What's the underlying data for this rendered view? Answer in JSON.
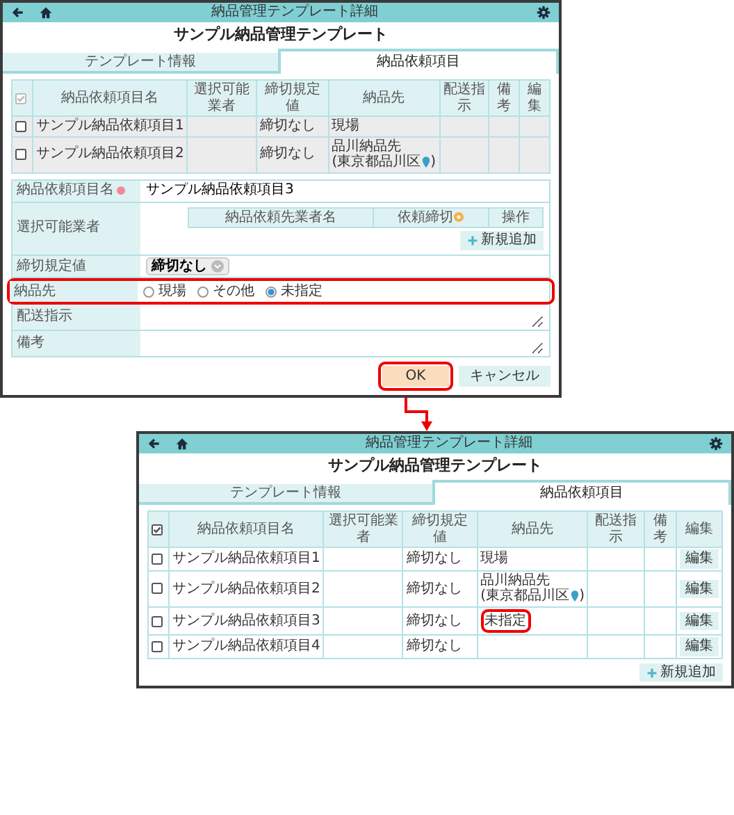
{
  "screens": [
    {
      "header": {
        "title": "納品管理テンプレート詳細"
      },
      "page_title": "サンプル納品管理テンプレート",
      "tabs": [
        {
          "label": "テンプレート情報",
          "selected": false
        },
        {
          "label": "納品依頼項目",
          "selected": true
        }
      ],
      "table": {
        "disabled": true,
        "select_all": {
          "checked": true,
          "disabled": true
        },
        "columns": [
          "納品依頼項目名",
          "選択可能業者",
          "締切規定値",
          "納品先",
          "配送指示",
          "備考",
          "編集"
        ],
        "rows": [
          {
            "selected": false,
            "name": "サンプル納品依頼項目1",
            "deadline": "締切なし",
            "destination": {
              "lines": [
                "現場"
              ]
            }
          },
          {
            "selected": false,
            "name": "サンプル納品依頼項目2",
            "deadline": "締切なし",
            "destination": {
              "lines": [
                "品川納品先",
                "(東京都品川区"
              ],
              "map_pin": true,
              "suffix": ")"
            }
          }
        ]
      },
      "form": {
        "fields": [
          {
            "kind": "text",
            "label": "納品依頼項目名",
            "required": true,
            "value": "サンプル納品依頼項目3"
          },
          {
            "kind": "vendors",
            "label": "選択可能業者",
            "columns": [
              {
                "label": "納品依頼先業者名"
              },
              {
                "label": "依頼締切",
                "info": true
              },
              {
                "label": "操作"
              }
            ],
            "add_button": "新規追加"
          },
          {
            "kind": "select",
            "label": "締切規定値",
            "value": "締切なし"
          },
          {
            "kind": "radio",
            "label": "納品先",
            "highlighted": true,
            "options": [
              {
                "label": "現場",
                "selected": false
              },
              {
                "label": "その他",
                "selected": false
              },
              {
                "label": "未指定",
                "selected": true
              }
            ]
          },
          {
            "kind": "textarea",
            "label": "配送指示"
          },
          {
            "kind": "textarea",
            "label": "備考"
          }
        ],
        "buttons": [
          {
            "label": "OK",
            "kind": "primary",
            "highlighted": true
          },
          {
            "label": "キャンセル",
            "kind": "secondary",
            "highlighted": false
          }
        ]
      }
    },
    {
      "header": {
        "title": "納品管理テンプレート詳細"
      },
      "page_title": "サンプル納品管理テンプレート",
      "tabs": [
        {
          "label": "テンプレート情報",
          "selected": false
        },
        {
          "label": "納品依頼項目",
          "selected": true
        }
      ],
      "table": {
        "disabled": false,
        "select_all": {
          "checked": true,
          "disabled": false
        },
        "columns": [
          "納品依頼項目名",
          "選択可能業者",
          "締切規定値",
          "納品先",
          "配送指示",
          "備考",
          "編集"
        ],
        "rows": [
          {
            "selected": false,
            "name": "サンプル納品依頼項目1",
            "deadline": "締切なし",
            "destination": {
              "lines": [
                "現場"
              ]
            },
            "edit": "編集"
          },
          {
            "selected": false,
            "name": "サンプル納品依頼項目2",
            "deadline": "締切なし",
            "destination": {
              "lines": [
                "品川納品先",
                "(東京都品川区"
              ],
              "map_pin": true,
              "suffix": ")"
            },
            "edit": "編集"
          },
          {
            "selected": false,
            "name": "サンプル納品依頼項目3",
            "deadline": "締切なし",
            "destination": {
              "lines": [
                "未指定"
              ],
              "highlighted": true
            },
            "edit": "編集"
          },
          {
            "selected": false,
            "name": "サンプル納品依頼項目4",
            "deadline": "締切なし",
            "edit": "編集"
          }
        ]
      },
      "add_button": "新規追加"
    }
  ]
}
